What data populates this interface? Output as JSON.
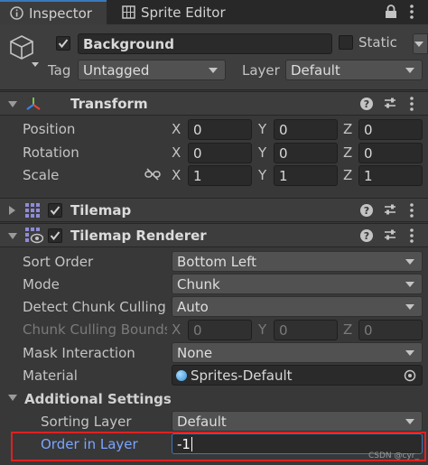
{
  "tabs": [
    {
      "label": "Inspector",
      "icon": "info-icon"
    },
    {
      "label": "Sprite Editor",
      "icon": "sprite-editor-icon"
    }
  ],
  "header": {
    "object_name": "Background",
    "static_label": "Static",
    "tag_label": "Tag",
    "tag_value": "Untagged",
    "layer_label": "Layer",
    "layer_value": "Default"
  },
  "transform": {
    "title": "Transform",
    "position": {
      "label": "Position",
      "x": "0",
      "y": "0",
      "z": "0"
    },
    "rotation": {
      "label": "Rotation",
      "x": "0",
      "y": "0",
      "z": "0"
    },
    "scale": {
      "label": "Scale",
      "x": "1",
      "y": "1",
      "z": "1"
    }
  },
  "tilemap": {
    "title": "Tilemap"
  },
  "tilemap_renderer": {
    "title": "Tilemap Renderer",
    "sort_order": {
      "label": "Sort Order",
      "value": "Bottom Left"
    },
    "mode": {
      "label": "Mode",
      "value": "Chunk"
    },
    "detect_chunk_culling": {
      "label": "Detect Chunk Culling",
      "value": "Auto"
    },
    "chunk_culling_bounds": {
      "label": "Chunk Culling Bounds",
      "x": "0",
      "y": "0",
      "z": "0"
    },
    "mask_interaction": {
      "label": "Mask Interaction",
      "value": "None"
    },
    "material": {
      "label": "Material",
      "value": "Sprites-Default"
    },
    "additional_settings": {
      "label": "Additional Settings"
    },
    "sorting_layer": {
      "label": "Sorting Layer",
      "value": "Default"
    },
    "order_in_layer": {
      "label": "Order in Layer",
      "value": "-1"
    }
  },
  "axis_labels": {
    "x": "X",
    "y": "Y",
    "z": "Z"
  },
  "watermark": "CSDN @cyr_",
  "colors": {
    "accent": "#3a79bb",
    "highlight": "#e02020",
    "selected_label": "#7aa6ff"
  }
}
